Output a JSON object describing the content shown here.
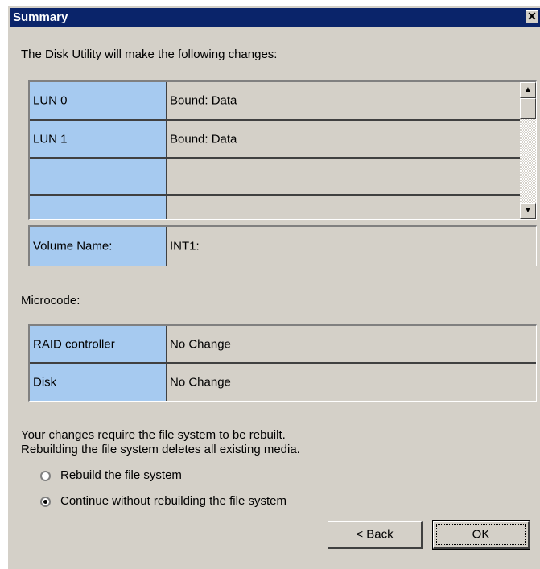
{
  "window": {
    "title": "Summary",
    "close_glyph": "✕"
  },
  "intro": "The Disk Utility will make the following changes:",
  "changes": [
    {
      "name": "LUN 0",
      "value": "Bound:   Data"
    },
    {
      "name": "LUN 1",
      "value": "Bound:   Data"
    },
    {
      "name": "",
      "value": ""
    },
    {
      "name": "",
      "value": ""
    }
  ],
  "volume": {
    "label": "Volume Name:",
    "value": "INT1:"
  },
  "microcode": {
    "heading": "Microcode:",
    "rows": [
      {
        "name": "RAID controller",
        "value": "No Change"
      },
      {
        "name": "Disk",
        "value": "No Change"
      }
    ]
  },
  "notice": {
    "line1": "Your changes require the file system to be rebuilt.",
    "line2": "Rebuilding the file system deletes all existing media."
  },
  "options": [
    {
      "label": "Rebuild the file system",
      "selected": false
    },
    {
      "label": "Continue without rebuilding the file system",
      "selected": true
    }
  ],
  "buttons": {
    "back": "< Back",
    "ok": "OK"
  },
  "scroll_arrows": {
    "up": "▲",
    "down": "▼"
  },
  "colors": {
    "title_bar": "#0a246a",
    "label_cell": "#a6caf0",
    "face": "#d4d0c8"
  }
}
